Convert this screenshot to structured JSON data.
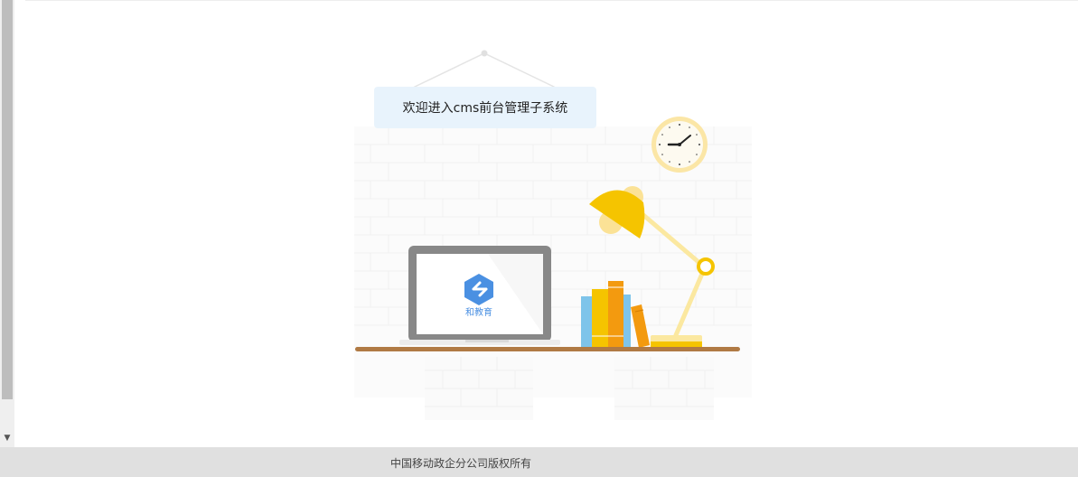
{
  "welcome": {
    "text": "欢迎进入cms前台管理子系统"
  },
  "laptop": {
    "logo_text": "和教育",
    "logo_color": "#4a90e2"
  },
  "footer": {
    "copyright": "中国移动政企分公司版权所有"
  },
  "colors": {
    "banner_bg": "#e8f3fc",
    "lamp": "#f5c400",
    "shelf": "#b07a44",
    "footer_bg": "#e0e0e0"
  },
  "icons": [
    "scroll-down-arrow-icon",
    "clock-icon",
    "desk-lamp-icon",
    "laptop-icon",
    "books-icon",
    "education-logo-icon"
  ]
}
